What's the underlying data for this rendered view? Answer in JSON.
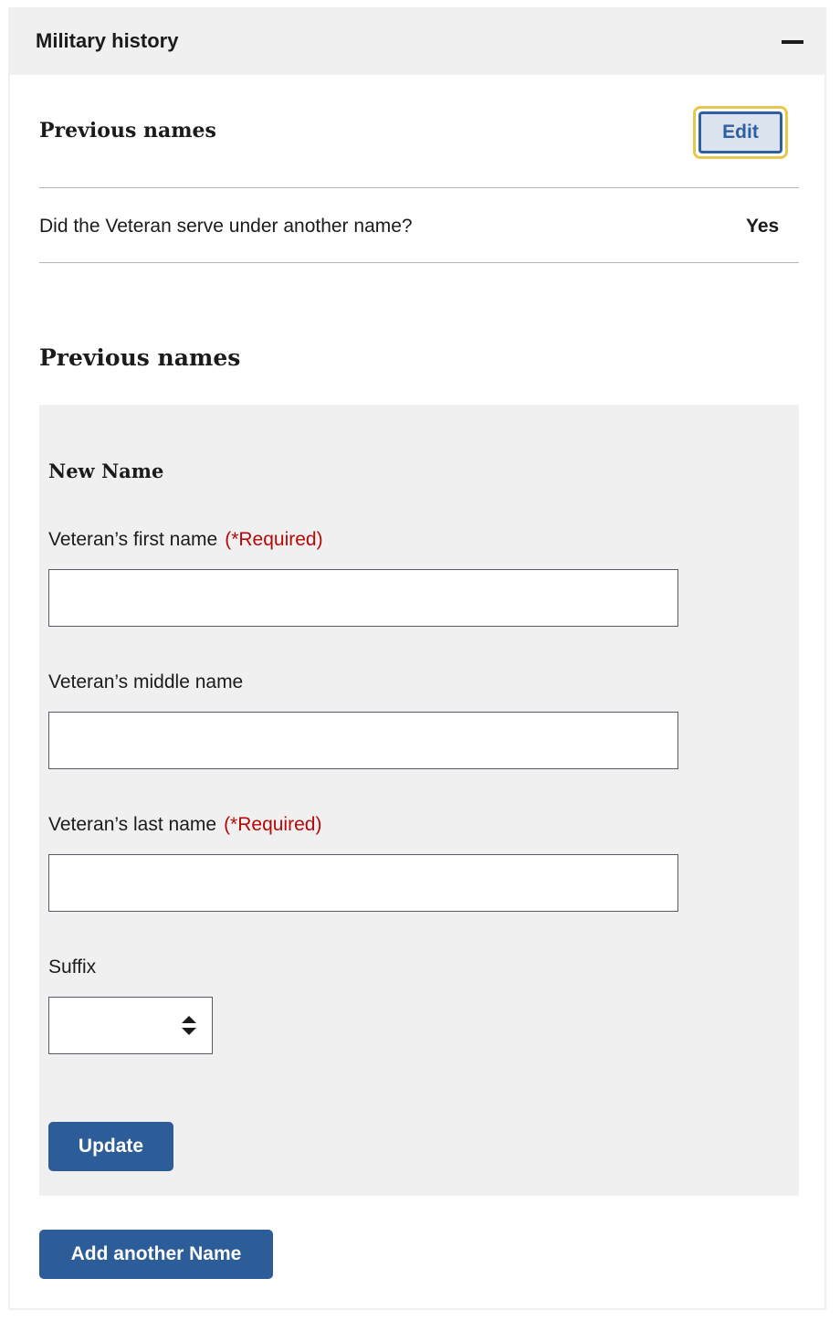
{
  "accordion": {
    "title": "Military history",
    "collapse_icon": "minus-icon"
  },
  "review": {
    "heading": "Previous names",
    "edit_label": "Edit",
    "question": "Did the Veteran serve under another name?",
    "answer": "Yes"
  },
  "form": {
    "heading": "Previous names",
    "card_heading": "New Name",
    "required_text": "(*Required)",
    "fields": {
      "first_name": {
        "label": "Veteran’s first name",
        "value": "",
        "required": true
      },
      "middle_name": {
        "label": "Veteran’s middle name",
        "value": ""
      },
      "last_name": {
        "label": "Veteran’s last name",
        "value": "",
        "required": true
      },
      "suffix": {
        "label": "Suffix",
        "value": "",
        "icon": "sort-arrows-icon"
      }
    },
    "update_label": "Update",
    "add_another_label": "Add another Name"
  },
  "colors": {
    "primary": "#2d5d98",
    "required": "#b50909",
    "focus_ring": "#e6c74c",
    "panel_bg": "#f0f0f0"
  }
}
